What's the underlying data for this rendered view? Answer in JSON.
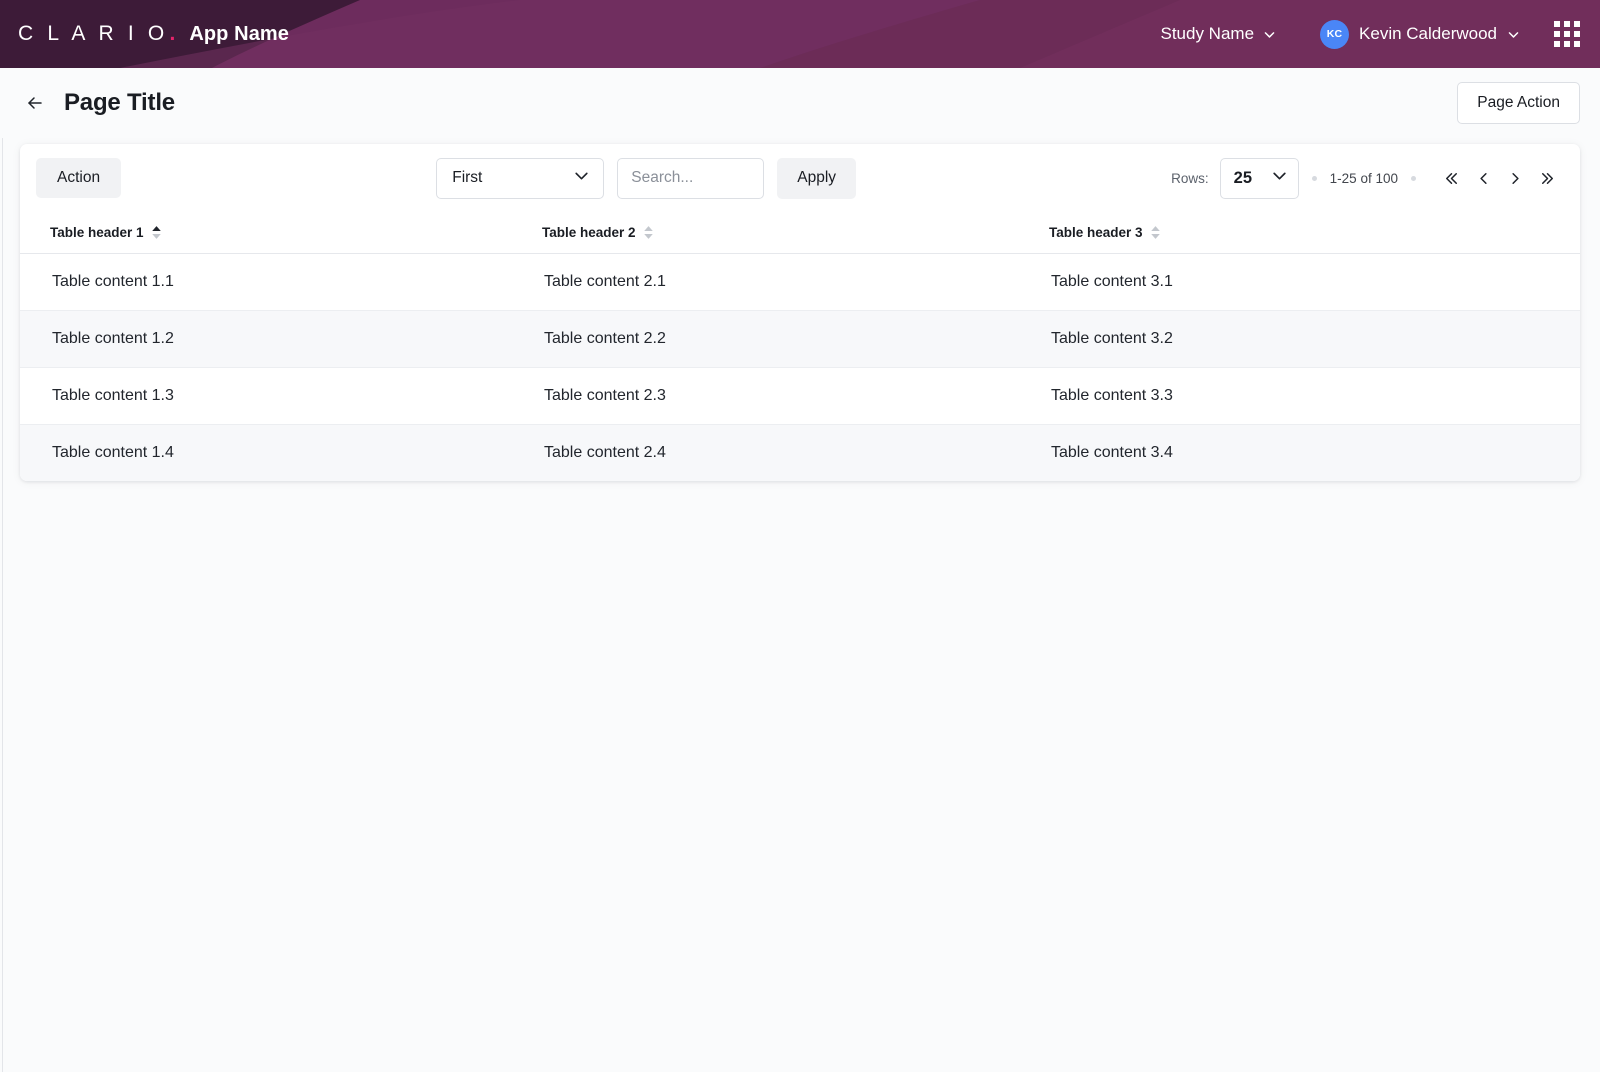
{
  "header": {
    "brand_logo": "C L A R I O",
    "brand_dot": ".",
    "app_name": "App Name",
    "study_label": "Study Name",
    "user_initials": "KC",
    "user_name": "Kevin Calderwood",
    "app_launcher_icon": "apps-grid-icon",
    "bg_color": "#6d2c5d",
    "accent_color": "#e6246b",
    "avatar_color": "#4a86f7"
  },
  "page": {
    "back_icon": "arrow-left-icon",
    "title": "Page Title",
    "action_label": "Page Action"
  },
  "toolbar": {
    "action_label": "Action",
    "filter_value": "First",
    "search_placeholder": "Search...",
    "search_value": "",
    "apply_label": "Apply"
  },
  "pagination": {
    "rows_label": "Rows:",
    "rows_value": "25",
    "range_text": "1-25 of 100",
    "first_icon": "chevrons-left-icon",
    "prev_icon": "chevron-left-icon",
    "next_icon": "chevron-right-icon",
    "last_icon": "chevrons-right-icon"
  },
  "table": {
    "columns": [
      {
        "label": "Table header 1",
        "sort": "asc"
      },
      {
        "label": "Table header 2",
        "sort": "none"
      },
      {
        "label": "Table header 3",
        "sort": "none"
      }
    ],
    "rows": [
      {
        "c1": "Table content 1.1",
        "c2": "Table content 2.1",
        "c3": "Table content 3.1"
      },
      {
        "c1": "Table content 1.2",
        "c2": "Table content 2.2",
        "c3": "Table content 3.2"
      },
      {
        "c1": "Table content 1.3",
        "c2": "Table content 2.3",
        "c3": "Table content 3.3"
      },
      {
        "c1": "Table content 1.4",
        "c2": "Table content 2.4",
        "c3": "Table content 3.4"
      }
    ]
  }
}
